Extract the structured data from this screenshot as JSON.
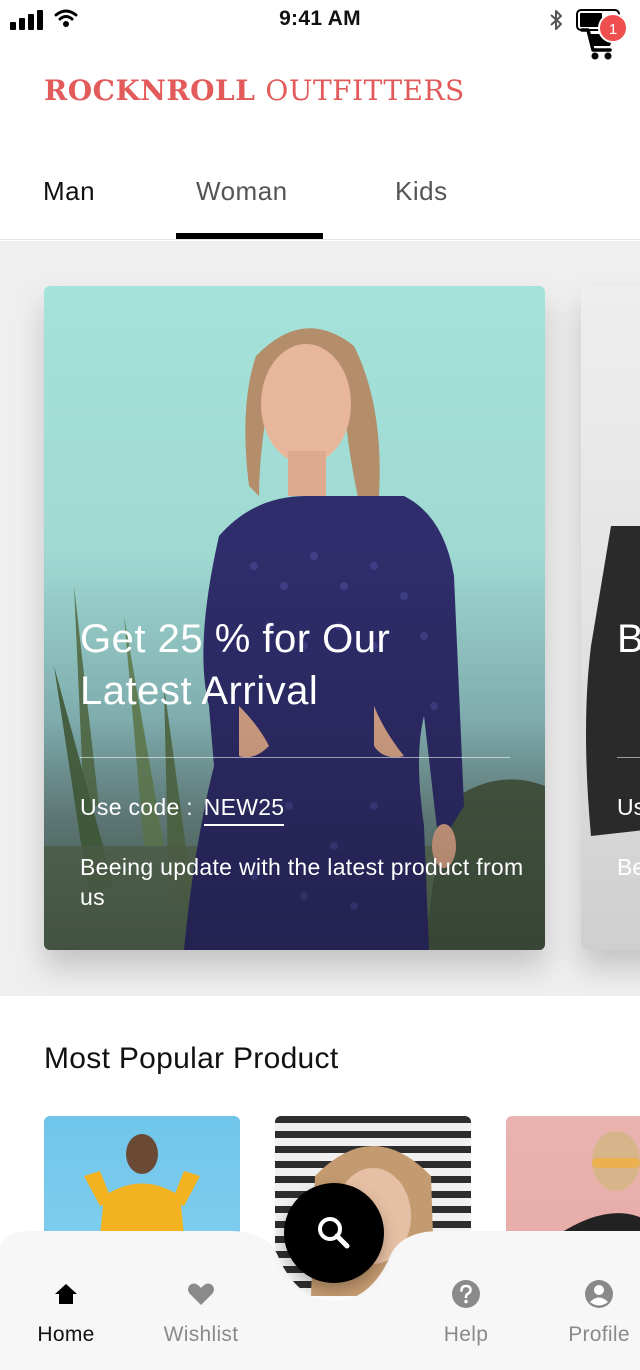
{
  "status_bar": {
    "time": "9:41 AM"
  },
  "header": {
    "brand_part1": "ROCKNROLL",
    "brand_part2": "OUTFITTERS",
    "cart_count": "1",
    "brand_color": "#e25a5a",
    "badge_color": "#ef4f4f"
  },
  "tabs": [
    {
      "label": "Man"
    },
    {
      "label": "Woman",
      "selected": true
    },
    {
      "label": "Kids"
    }
  ],
  "banners": [
    {
      "title": "Get 25 % for Our Latest Arrival",
      "code_label": "Use code :",
      "code": "NEW25",
      "description": "Beeing update with the latest product from us"
    },
    {
      "title": "B c",
      "code_label": "Us",
      "description": "Be fa"
    }
  ],
  "popular": {
    "title": "Most Popular Product"
  },
  "bottom_nav": {
    "items": [
      {
        "label": "Home",
        "icon": "home-icon",
        "active": true
      },
      {
        "label": "Wishlist",
        "icon": "heart-icon"
      },
      {
        "label": "Help",
        "icon": "help-icon"
      },
      {
        "label": "Profile",
        "icon": "profile-icon"
      }
    ],
    "fab_icon": "search-icon"
  }
}
